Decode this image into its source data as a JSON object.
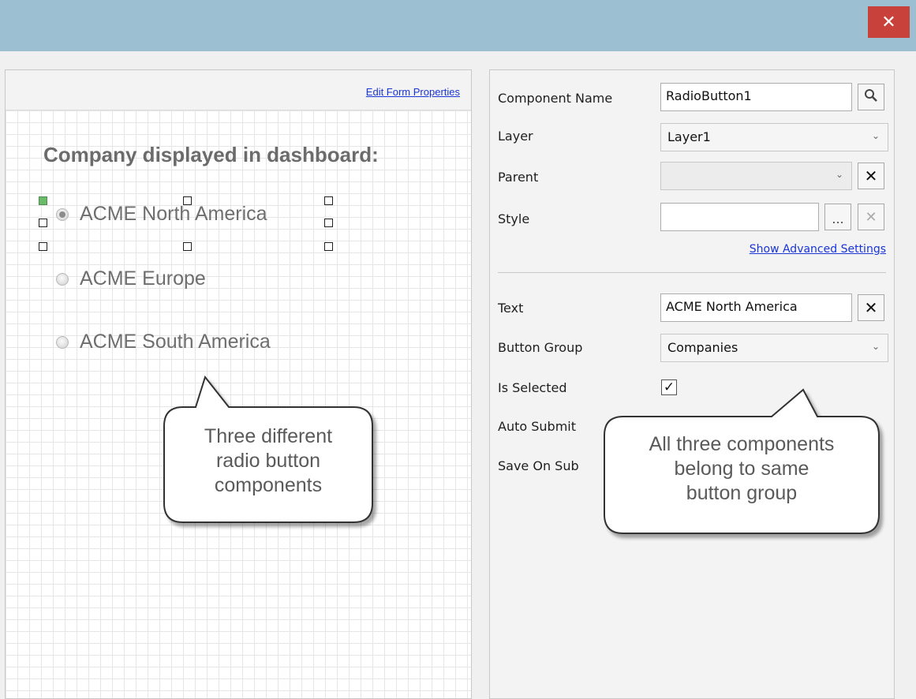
{
  "window": {
    "close_glyph": "✕"
  },
  "canvas": {
    "edit_link": "Edit Form Properties",
    "form_title": "Company displayed in dashboard:",
    "radios": [
      {
        "label": "ACME North America",
        "selected": true
      },
      {
        "label": "ACME Europe",
        "selected": false
      },
      {
        "label": "ACME South America",
        "selected": false
      }
    ]
  },
  "callouts": {
    "left_lines": [
      "Three different",
      "radio button",
      "components"
    ],
    "right_lines": [
      "All three components",
      "belong to same",
      "button group"
    ]
  },
  "properties": {
    "component_name_label": "Component Name",
    "component_name_value": "RadioButton1",
    "layer_label": "Layer",
    "layer_value": "Layer1",
    "parent_label": "Parent",
    "parent_value": "",
    "style_label": "Style",
    "style_value": "",
    "style_browse_glyph": "...",
    "advanced_link": "Show Advanced Settings",
    "text_label": "Text",
    "text_value": "ACME North America",
    "button_group_label": "Button Group",
    "button_group_value": "Companies",
    "is_selected_label": "Is Selected",
    "is_selected_checked": true,
    "auto_submit_label": "Auto Submit",
    "save_on_submit_label": "Save On Sub"
  },
  "icons": {
    "close": "close-icon",
    "search": "magnifier-icon",
    "clear": "x-icon",
    "dropdown": "chevron-down-icon",
    "checkmark": "checkmark-icon"
  },
  "colors": {
    "titlebar": "#9dbfd2",
    "close_button": "#c9413b",
    "link": "#1a35d6",
    "selected_handle": "#6aba6a"
  }
}
